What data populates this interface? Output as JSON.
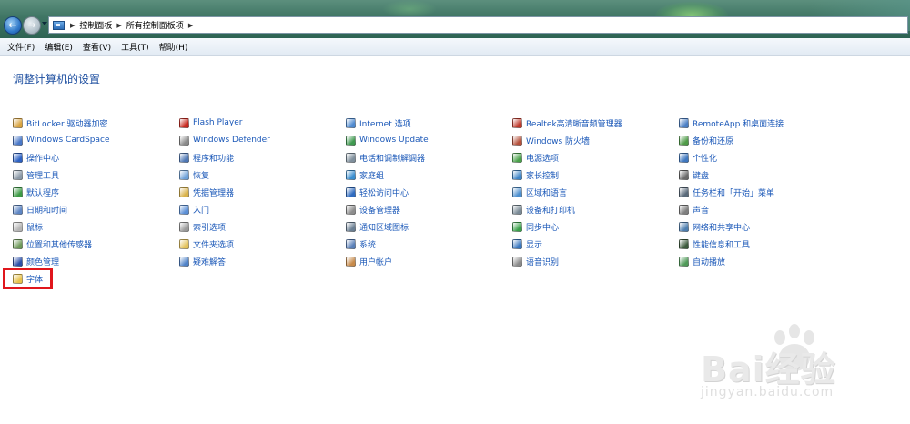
{
  "breadcrumb": [
    "控制面板",
    "所有控制面板项"
  ],
  "menu": [
    "文件(F)",
    "编辑(E)",
    "查看(V)",
    "工具(T)",
    "帮助(H)"
  ],
  "page_title": "调整计算机的设置",
  "columns": [
    [
      {
        "name": "BitLocker 驱动器加密",
        "icon": "bitlocker-icon",
        "color": "#d9a441"
      },
      {
        "name": "Windows CardSpace",
        "icon": "cardspace-icon",
        "color": "#4a78c8"
      },
      {
        "name": "操作中心",
        "icon": "action-center-flag-icon",
        "color": "#2d62c4"
      },
      {
        "name": "管理工具",
        "icon": "admin-tools-icon",
        "color": "#8c9aa8"
      },
      {
        "name": "默认程序",
        "icon": "default-programs-icon",
        "color": "#3d9b45"
      },
      {
        "name": "日期和时间",
        "icon": "clock-icon",
        "color": "#5e86c4"
      },
      {
        "name": "鼠标",
        "icon": "mouse-icon",
        "color": "#b5b5b5"
      },
      {
        "name": "位置和其他传感器",
        "icon": "sensor-icon",
        "color": "#6f9a5a"
      },
      {
        "name": "颜色管理",
        "icon": "color-management-icon",
        "color": "#2b4fa8"
      },
      {
        "name": "字体",
        "icon": "fonts-folder-icon",
        "color": "#e8c24a"
      }
    ],
    [
      {
        "name": "Flash Player",
        "icon": "flash-icon",
        "color": "#c8281e"
      },
      {
        "name": "Windows Defender",
        "icon": "defender-icon",
        "color": "#8a8a8a"
      },
      {
        "name": "程序和功能",
        "icon": "programs-icon",
        "color": "#4f78b5"
      },
      {
        "name": "恢复",
        "icon": "recovery-icon",
        "color": "#6da0d8"
      },
      {
        "name": "凭据管理器",
        "icon": "credential-icon",
        "color": "#d9b24a"
      },
      {
        "name": "入门",
        "icon": "getting-started-icon",
        "color": "#5b8fd6"
      },
      {
        "name": "索引选项",
        "icon": "indexing-icon",
        "color": "#9a9a9a"
      },
      {
        "name": "文件夹选项",
        "icon": "folder-options-icon",
        "color": "#e3c15a"
      },
      {
        "name": "疑难解答",
        "icon": "troubleshoot-icon",
        "color": "#4f82c8"
      }
    ],
    [
      {
        "name": "Internet 选项",
        "icon": "internet-options-icon",
        "color": "#4f8ad0"
      },
      {
        "name": "Windows Update",
        "icon": "windows-update-icon",
        "color": "#3f9a50"
      },
      {
        "name": "电话和调制解调器",
        "icon": "phone-modem-icon",
        "color": "#7f8f9c"
      },
      {
        "name": "家庭组",
        "icon": "homegroup-icon",
        "color": "#3b8fd0"
      },
      {
        "name": "轻松访问中心",
        "icon": "ease-of-access-icon",
        "color": "#2f6bc0"
      },
      {
        "name": "设备管理器",
        "icon": "device-manager-icon",
        "color": "#8d8d8d"
      },
      {
        "name": "通知区域图标",
        "icon": "notification-icon",
        "color": "#6b7f93"
      },
      {
        "name": "系统",
        "icon": "system-icon",
        "color": "#5a80b8"
      },
      {
        "name": "用户帐户",
        "icon": "user-accounts-icon",
        "color": "#c78a4a"
      }
    ],
    [
      {
        "name": "Realtek高清晰音频管理器",
        "icon": "realtek-audio-icon",
        "color": "#c0392b"
      },
      {
        "name": "Windows 防火墙",
        "icon": "firewall-icon",
        "color": "#b5503a"
      },
      {
        "name": "电源选项",
        "icon": "power-options-icon",
        "color": "#4aa24a"
      },
      {
        "name": "家长控制",
        "icon": "parental-controls-icon",
        "color": "#3f86c8"
      },
      {
        "name": "区域和语言",
        "icon": "region-language-icon",
        "color": "#4c8fcf"
      },
      {
        "name": "设备和打印机",
        "icon": "devices-printers-icon",
        "color": "#7a8a96"
      },
      {
        "name": "同步中心",
        "icon": "sync-center-icon",
        "color": "#3aa14a"
      },
      {
        "name": "显示",
        "icon": "display-icon",
        "color": "#3a78c0"
      },
      {
        "name": "语音识别",
        "icon": "speech-recognition-icon",
        "color": "#8a8a8a"
      }
    ],
    [
      {
        "name": "RemoteApp 和桌面连接",
        "icon": "remoteapp-icon",
        "color": "#4b7fc4"
      },
      {
        "name": "备份和还原",
        "icon": "backup-restore-icon",
        "color": "#4f9b48"
      },
      {
        "name": "个性化",
        "icon": "personalization-icon",
        "color": "#3f78c0"
      },
      {
        "name": "键盘",
        "icon": "keyboard-icon",
        "color": "#6a6a6a"
      },
      {
        "name": "任务栏和「开始」菜单",
        "icon": "taskbar-icon",
        "color": "#5a6a7a"
      },
      {
        "name": "声音",
        "icon": "sound-icon",
        "color": "#7f7f7f"
      },
      {
        "name": "网络和共享中心",
        "icon": "network-sharing-icon",
        "color": "#4f7fb0"
      },
      {
        "name": "性能信息和工具",
        "icon": "performance-icon",
        "color": "#3c5a3c"
      },
      {
        "name": "自动播放",
        "icon": "autoplay-icon",
        "color": "#4f9a58"
      }
    ]
  ],
  "highlight_item": "字体",
  "watermark": {
    "brand": "Bai经验",
    "url": "jingyan.baidu.com"
  }
}
